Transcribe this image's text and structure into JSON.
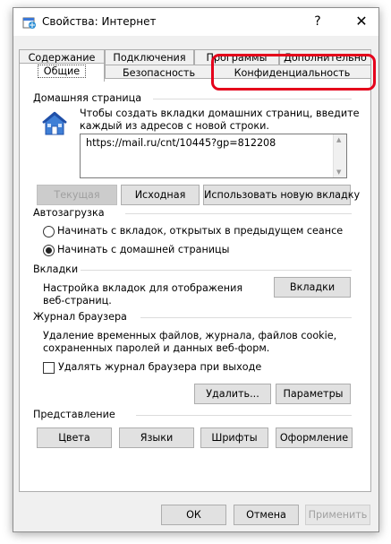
{
  "window": {
    "title": "Свойства: Интернет",
    "help_glyph": "?",
    "close_glyph": "✕"
  },
  "tabs_row1": [
    "Содержание",
    "Подключения",
    "Программы",
    "Дополнительно"
  ],
  "tabs_row2": [
    "Общие",
    "Безопасность",
    "Конфиденциальность"
  ],
  "active_tab": "Общие",
  "home_page": {
    "group_title": "Домашняя страница",
    "description_line1": "Чтобы создать вкладки домашних страниц, введите",
    "description_line2": "каждый из адресов с новой строки.",
    "url": "https://mail.ru/cnt/10445?gp=812208",
    "btn_current": "Текущая",
    "btn_default": "Исходная",
    "btn_new_tab": "Использовать новую вкладку"
  },
  "startup": {
    "group_title": "Автозагрузка",
    "option_restore": "Начинать с вкладок, открытых в предыдущем сеансе",
    "option_home": "Начинать с домашней страницы",
    "selected": "option_home"
  },
  "tabs_section": {
    "group_title": "Вкладки",
    "description_line1": "Настройка вкладок для отображения",
    "description_line2": "веб-страниц.",
    "btn_tabs": "Вкладки"
  },
  "history": {
    "group_title": "Журнал браузера",
    "description_line1": "Удаление временных файлов, журнала, файлов cookie,",
    "description_line2": "сохраненных паролей и данных веб-форм.",
    "checkbox_label": "Удалять журнал браузера при выходе",
    "checkbox_checked": false,
    "btn_delete": "Удалить...",
    "btn_settings": "Параметры"
  },
  "appearance": {
    "group_title": "Представление",
    "btn_colors": "Цвета",
    "btn_languages": "Языки",
    "btn_fonts": "Шрифты",
    "btn_accessibility": "Оформление"
  },
  "footer": {
    "btn_ok": "ОК",
    "btn_cancel": "Отмена",
    "btn_apply": "Применить"
  },
  "colors": {
    "highlight": "#e5001b",
    "icon_blue": "#2a66c8"
  }
}
